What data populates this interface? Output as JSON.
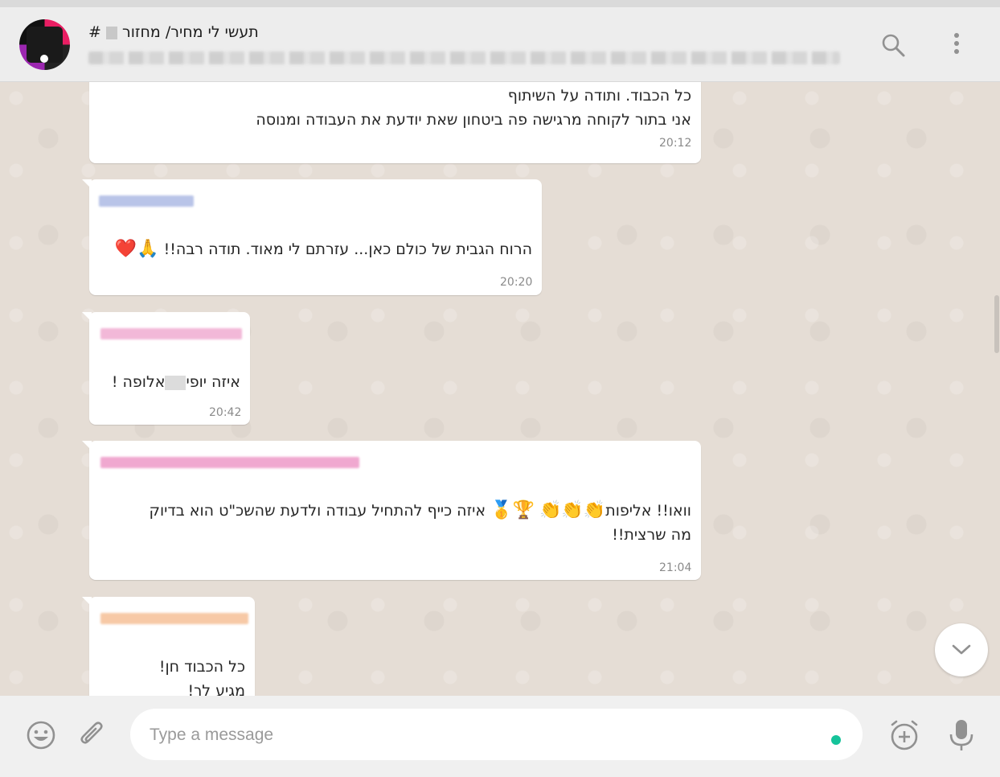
{
  "header": {
    "title_prefix": "#",
    "title_main": "תעשי לי מחיר/ מחזור",
    "avatar_alt": "group-avatar"
  },
  "messages": [
    {
      "lines": [
        "כל הכבוד. ותודה על השיתוף",
        "אני בתור לקוחה מרגישה פה ביטחון שאת יודעת את העבודה ומנוסה"
      ],
      "time": "20:12"
    },
    {
      "lines": [
        "הרוח הגבית של כולם כאן... עזרתם לי מאוד. תודה רבה!!"
      ],
      "emojis": "🙏❤️",
      "time": "20:20",
      "sender_color": "#b9c4e8"
    },
    {
      "text_before": "איזה יופי",
      "text_after": "אלופה !",
      "time": "20:42",
      "sender_color": "#f2b8d8"
    },
    {
      "line1_before": "וואו!! אליפות",
      "emojis_clap": "👏👏👏",
      "emojis_trophy": "🏆🥇",
      "line1_after": "איזה כייף להתחיל עבודה ולדעת שהשכ\"ט הוא בדיוק",
      "line2": "מה שרצית!!",
      "time": "21:04",
      "sender_color": "#f0a8d0"
    },
    {
      "lines": [
        "כל הכבוד חן!",
        "מגיע לך!"
      ],
      "sender_color": "#f7c9a6"
    }
  ],
  "composer": {
    "placeholder": "Type a message"
  },
  "colors": {
    "chat_bg": "#e5ddd5",
    "accent_green": "#15c39a",
    "icon_gray": "#919191"
  }
}
